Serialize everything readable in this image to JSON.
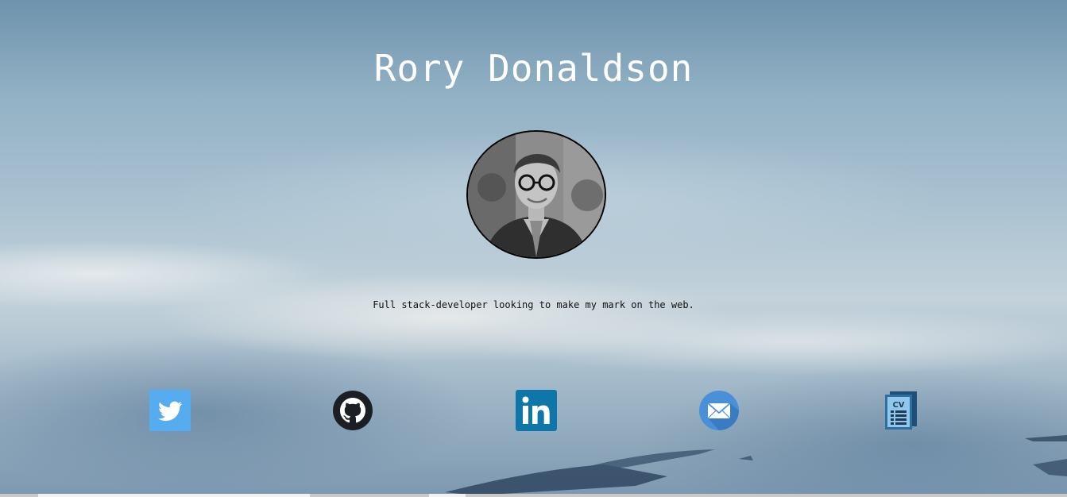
{
  "header": {
    "name": "Rory Donaldson"
  },
  "profile": {
    "avatar_alt": "Profile photo"
  },
  "intro": {
    "tagline": "Full stack-developer looking to make my mark on the web."
  },
  "social_links": [
    {
      "label": "Twitter",
      "icon": "twitter-icon",
      "color": "#55acee"
    },
    {
      "label": "GitHub",
      "icon": "github-icon",
      "color": "#1b1f23"
    },
    {
      "label": "LinkedIn",
      "icon": "linkedin-icon",
      "color": "#0e76a8"
    },
    {
      "label": "Email",
      "icon": "envelope-icon",
      "color": "#4a90d9"
    },
    {
      "label": "CV",
      "icon": "cv-document-icon",
      "color": "#2e6f9e"
    }
  ],
  "colors": {
    "title_text": "#ffffff",
    "tagline_text": "#111111",
    "avatar_border": "#000000"
  }
}
